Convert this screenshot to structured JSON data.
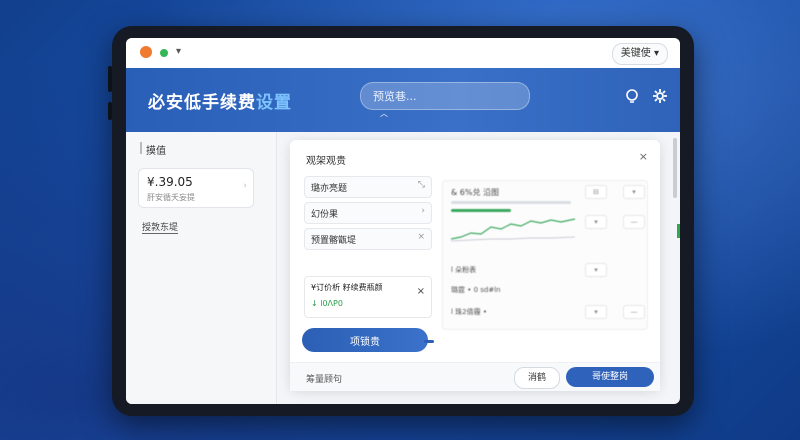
{
  "topbar": {
    "language_label": "美键使",
    "language_caret": "▾",
    "menu_caret": "▾"
  },
  "header": {
    "title_main": "必安低手续费",
    "title_accent": "设置",
    "search_placeholder": "预览巷..."
  },
  "sidebar": {
    "heading": "摸值",
    "card_amount": "¥.39.05",
    "card_subtitle": "肝安循夭妄提",
    "link": "授敦东堤"
  },
  "modal": {
    "title": "观架观贵",
    "close": "×",
    "rows": [
      {
        "label": "璐亦亮题",
        "icon": "⤡"
      },
      {
        "label": "幻份果",
        "icon": "›"
      },
      {
        "label": "预置髂甑堤",
        "icon": "×"
      }
    ],
    "promo_title": "¥订价析  籽续费瓶颜",
    "promo_green": "↓ l0ΛΡ0",
    "promo_close": "×",
    "brush_button": "项锁贵",
    "right_panel": {
      "title": "& 6%兑 沿图",
      "rows": [
        "l 朵粉表",
        "璐霆 • 0 sd#ln",
        "l 珠2倩霾 •"
      ]
    },
    "footer_text": "筹量顾句",
    "cancel_button": "消鹤",
    "confirm_button": "哥使整岗"
  },
  "colors": {
    "accent": "#2e62bb",
    "hero": "#2a5fb8",
    "success": "#2fa84f",
    "logo": "#f07a2e"
  }
}
